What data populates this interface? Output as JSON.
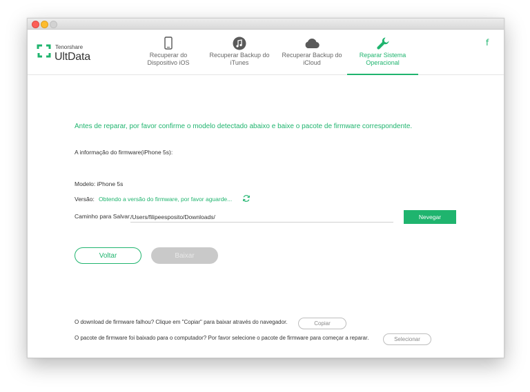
{
  "brand": {
    "company": "Tenorshare",
    "product": "UltData"
  },
  "nav": {
    "tabs": [
      {
        "line1": "Recuperar do",
        "line2": "Dispositivo iOS",
        "icon": "phone-icon"
      },
      {
        "line1": "Recuperar Backup do",
        "line2": "iTunes",
        "icon": "music-icon"
      },
      {
        "line1": "Recuperar Backup do",
        "line2": "iCloud",
        "icon": "cloud-icon"
      },
      {
        "line1": "Reparar Sistema",
        "line2": "Operacional",
        "icon": "wrench-icon",
        "active": true
      }
    ],
    "facebook": "f"
  },
  "main": {
    "instruction": "Antes de reparar, por favor confirme o modelo detectado abaixo e baixe o pacote de firmware correspondente.",
    "firmware_info": "A informação do firmware(iPhone 5s):",
    "model": "Modelo: iPhone 5s",
    "version_label": "Versão:",
    "version_status": "Obtendo a versão do firmware, por favor aguarde...",
    "save_path_label": "Caminho para Salvar:",
    "save_path_value": "/Users/filipeesposito/Downloads/",
    "browse_label": "Nevegar",
    "back_label": "Voltar",
    "download_label": "Baixar"
  },
  "footer": {
    "copy_text": "O download de firmware falhou? Clique em \"Copiar\" para baixar através do navegador.",
    "copy_label": "Copiar",
    "select_text": "O pacote de firmware foi baixado para o computador? Por favor selecione o pacote de firmware para começar a reparar.",
    "select_label": "Selecionar"
  },
  "colors": {
    "accent": "#1fb46e",
    "disabled": "#c9c9c9"
  }
}
